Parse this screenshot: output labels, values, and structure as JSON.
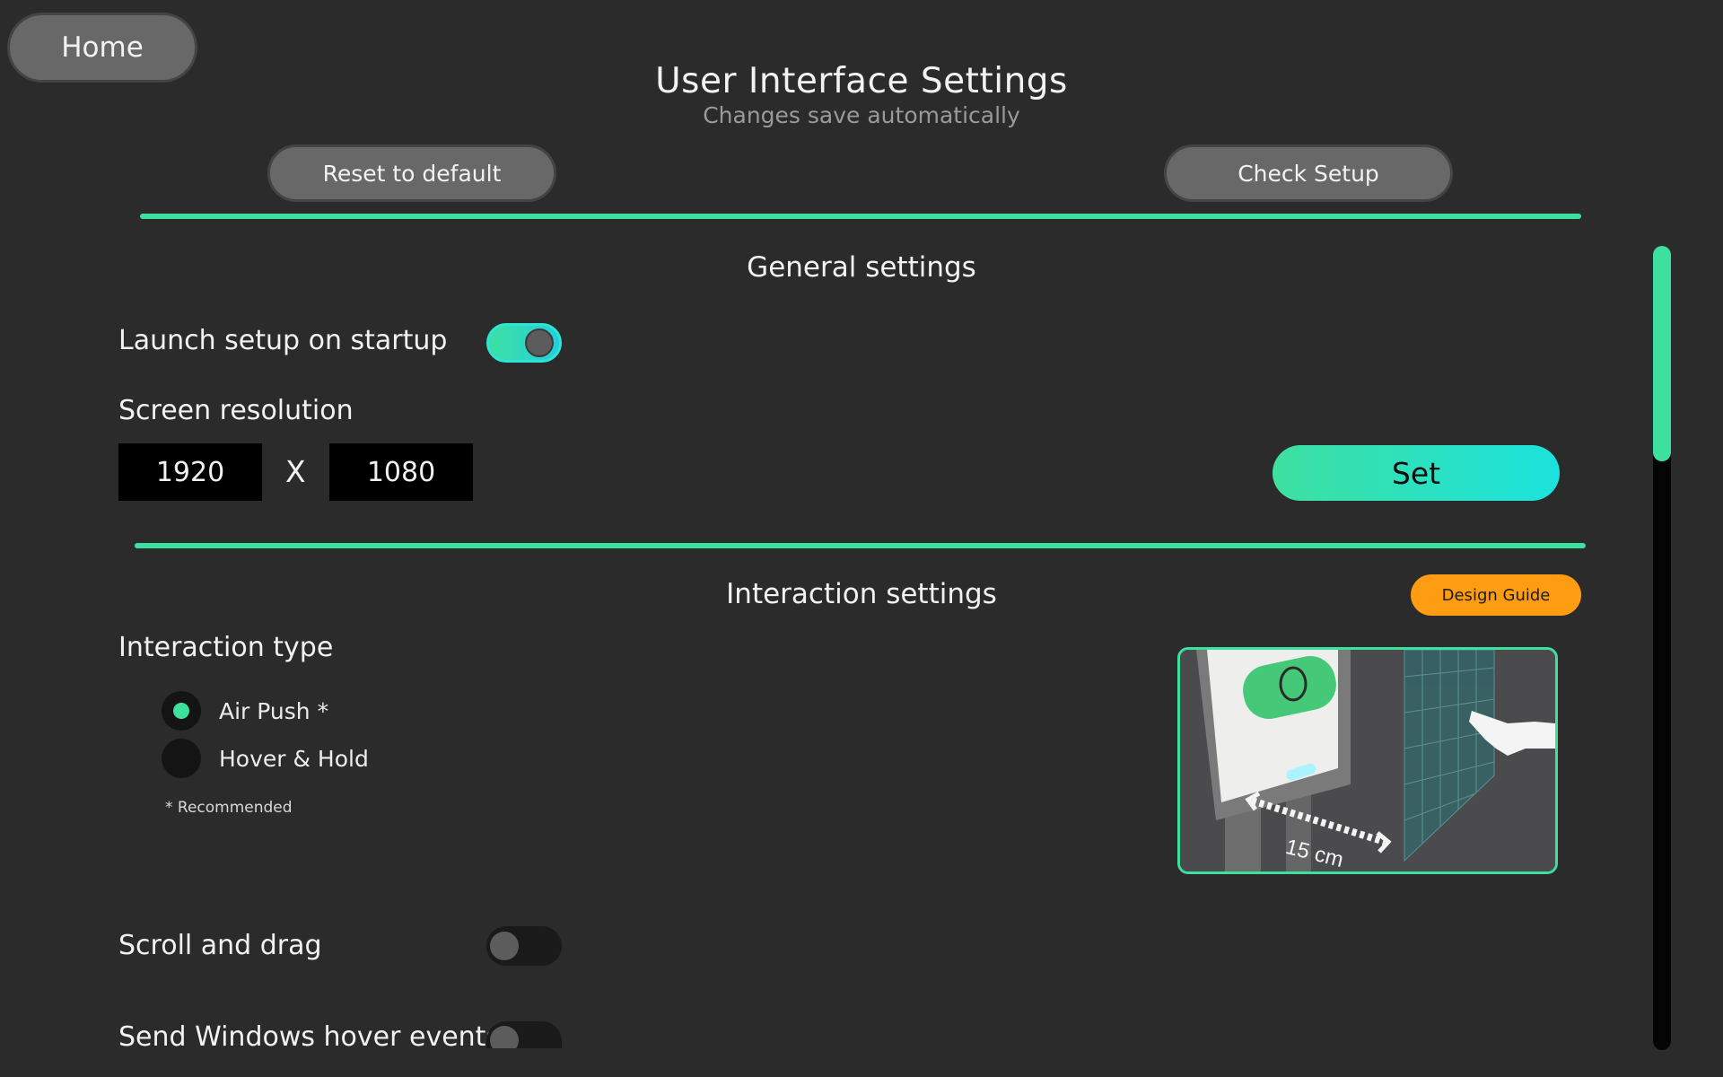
{
  "header": {
    "home_label": "Home",
    "title": "User Interface Settings",
    "subtitle": "Changes save automatically",
    "reset_label": "Reset to default",
    "check_setup_label": "Check Setup"
  },
  "general": {
    "title": "General settings",
    "launch_setup_label": "Launch setup on startup",
    "launch_setup_enabled": true,
    "resolution_label": "Screen resolution",
    "resolution_width": "1920",
    "resolution_separator": "X",
    "resolution_height": "1080",
    "set_label": "Set"
  },
  "interaction": {
    "title": "Interaction settings",
    "design_guide_label": "Design Guide",
    "type_label": "Interaction type",
    "options": [
      {
        "label": "Air Push *",
        "selected": true
      },
      {
        "label": "Hover & Hold",
        "selected": false
      }
    ],
    "recommended_note": "* Recommended",
    "illustration_distance": "15 cm",
    "scroll_drag_label": "Scroll and drag",
    "scroll_drag_enabled": false,
    "hover_events_label": "Send Windows hover events",
    "hover_events_enabled": false
  },
  "colors": {
    "background": "#2b2b2b",
    "accent": "#3ee0a0",
    "accent_cyan": "#1be2dd",
    "design_guide": "#ff9d12",
    "button_gray": "#686868"
  },
  "icons": {
    "illustration": "kiosk-hand-distance-illustration"
  }
}
